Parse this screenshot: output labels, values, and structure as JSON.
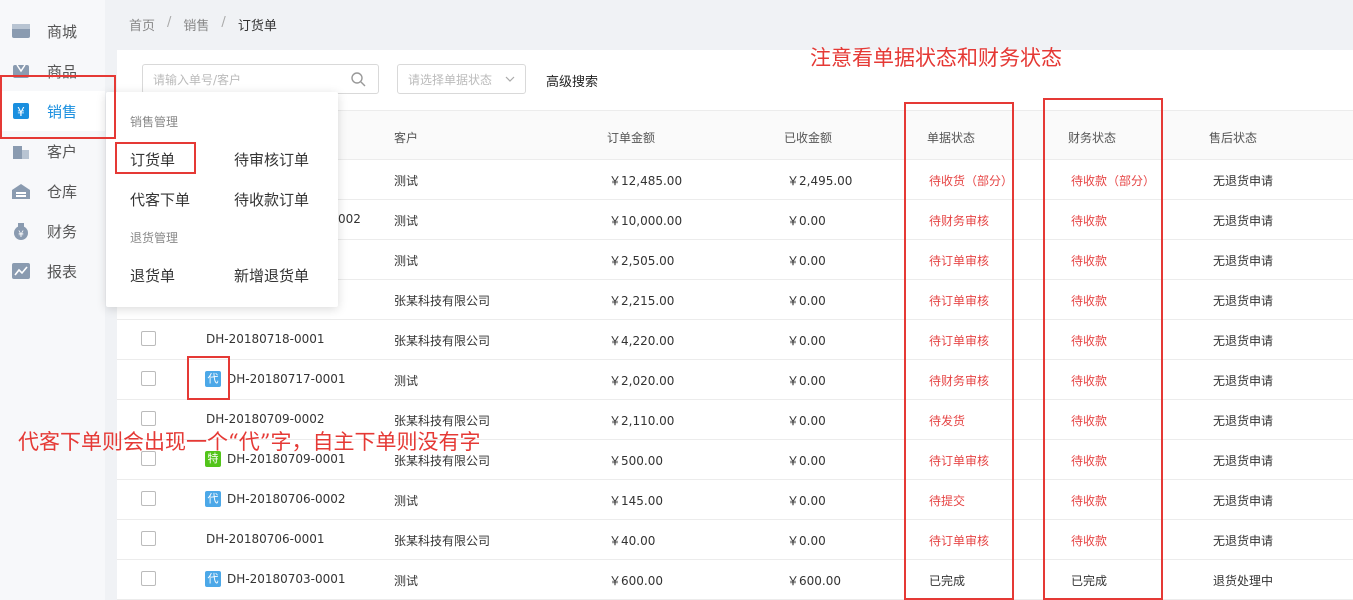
{
  "sidebar": {
    "items": [
      {
        "label": "商城",
        "icon": "store-icon"
      },
      {
        "label": "商品",
        "icon": "goods-icon"
      },
      {
        "label": "销售",
        "icon": "sales-icon"
      },
      {
        "label": "客户",
        "icon": "customer-icon"
      },
      {
        "label": "仓库",
        "icon": "warehouse-icon"
      },
      {
        "label": "财务",
        "icon": "finance-icon"
      },
      {
        "label": "报表",
        "icon": "report-icon"
      }
    ],
    "active_index": 2
  },
  "breadcrumb": [
    "首页",
    "销售",
    "订货单"
  ],
  "search": {
    "placeholder": "请输入单号/客户",
    "status_placeholder": "请选择单据状态",
    "advanced_label": "高级搜索"
  },
  "table": {
    "headers": [
      "客户",
      "订单金额",
      "已收金额",
      "单据状态",
      "财务状态",
      "售后状态"
    ],
    "rows": [
      {
        "order_no": "",
        "tag": "",
        "customer": "测试",
        "amount": "￥12,485.00",
        "received": "￥2,495.00",
        "doc_status": "待收货（部分）",
        "fin_status": "待收款（部分）",
        "after_sale": "无退货申请"
      },
      {
        "order_no": "002",
        "tag": "",
        "customer": "测试",
        "amount": "￥10,000.00",
        "received": "￥0.00",
        "doc_status": "待财务审核",
        "fin_status": "待收款",
        "after_sale": "无退货申请"
      },
      {
        "order_no": "",
        "tag": "",
        "customer": "测试",
        "amount": "￥2,505.00",
        "received": "￥0.00",
        "doc_status": "待订单审核",
        "fin_status": "待收款",
        "after_sale": "无退货申请"
      },
      {
        "order_no": "",
        "tag": "",
        "customer": "张某科技有限公司",
        "amount": "￥2,215.00",
        "received": "￥0.00",
        "doc_status": "待订单审核",
        "fin_status": "待收款",
        "after_sale": "无退货申请"
      },
      {
        "order_no": "DH-20180718-0001",
        "tag": "",
        "customer": "张某科技有限公司",
        "amount": "￥4,220.00",
        "received": "￥0.00",
        "doc_status": "待订单审核",
        "fin_status": "待收款",
        "after_sale": "无退货申请"
      },
      {
        "order_no": "DH-20180717-0001",
        "tag": "代",
        "customer": "测试",
        "amount": "￥2,020.00",
        "received": "￥0.00",
        "doc_status": "待财务审核",
        "fin_status": "待收款",
        "after_sale": "无退货申请"
      },
      {
        "order_no": "DH-20180709-0002",
        "tag": "",
        "customer": "张某科技有限公司",
        "amount": "￥2,110.00",
        "received": "￥0.00",
        "doc_status": "待发货",
        "fin_status": "待收款",
        "after_sale": "无退货申请"
      },
      {
        "order_no": "DH-20180709-0001",
        "tag": "特",
        "customer": "张某科技有限公司",
        "amount": "￥500.00",
        "received": "￥0.00",
        "doc_status": "待订单审核",
        "fin_status": "待收款",
        "after_sale": "无退货申请"
      },
      {
        "order_no": "DH-20180706-0002",
        "tag": "代",
        "customer": "测试",
        "amount": "￥145.00",
        "received": "￥0.00",
        "doc_status": "待提交",
        "fin_status": "待收款",
        "after_sale": "无退货申请"
      },
      {
        "order_no": "DH-20180706-0001",
        "tag": "",
        "customer": "张某科技有限公司",
        "amount": "￥40.00",
        "received": "￥0.00",
        "doc_status": "待订单审核",
        "fin_status": "待收款",
        "after_sale": "无退货申请"
      },
      {
        "order_no": "DH-20180703-0001",
        "tag": "代",
        "customer": "测试",
        "amount": "￥600.00",
        "received": "￥600.00",
        "doc_status": "已完成",
        "fin_status": "已完成",
        "after_sale": "退货处理中"
      }
    ]
  },
  "menu": {
    "group1": "销售管理",
    "item_order": "订货单",
    "item_pending_review": "待审核订单",
    "item_proxy_order": "代客下单",
    "item_pending_payment": "待收款订单",
    "group2": "退货管理",
    "item_return": "退货单",
    "item_add_return": "新增退货单"
  },
  "annotations": {
    "status_note": "注意看单据状态和财务状态",
    "proxy_note": "代客下单则会出现一个“代”字，自主下单则没有字"
  },
  "colors": {
    "accent": "#1a8fdf",
    "status_red": "#e64545",
    "annotation_red": "#e53935",
    "tag_blue": "#4ca8e8",
    "tag_green": "#52c41a"
  }
}
